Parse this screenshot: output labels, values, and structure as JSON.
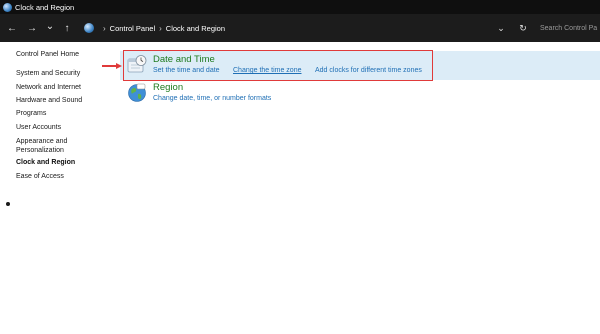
{
  "window": {
    "title": "Clock and Region"
  },
  "nav": {
    "back": "←",
    "forward": "→",
    "dropdown": "⌄",
    "up": "↑",
    "refresh": "↻",
    "history": "⌄"
  },
  "breadcrumb": {
    "items": [
      "Control Panel",
      "Clock and Region"
    ],
    "separator": "›"
  },
  "search": {
    "placeholder": "Search Control Pa"
  },
  "sidebar": {
    "items": [
      {
        "label": "Control Panel Home"
      },
      {
        "label": "System and Security"
      },
      {
        "label": "Network and Internet"
      },
      {
        "label": "Hardware and Sound"
      },
      {
        "label": "Programs"
      },
      {
        "label": "User Accounts"
      },
      {
        "label": "Appearance and"
      },
      {
        "label": "Personalization"
      },
      {
        "label": "Clock and Region",
        "active": true
      },
      {
        "label": "Ease of Access"
      }
    ]
  },
  "categories": [
    {
      "title": "Date and Time",
      "icon": "date-time-icon",
      "links": [
        "Set the time and date",
        "Change the time zone",
        "Add clocks for different time zones"
      ]
    },
    {
      "title": "Region",
      "icon": "region-globe-icon",
      "links": [
        "Change date, time, or number formats"
      ]
    }
  ],
  "colors": {
    "accent_highlight": "#dcecf7",
    "annotation_red": "#e03a3a",
    "title_green": "#1e7a1e",
    "link_blue": "#1f6fb5",
    "titlebar_bg": "#0f0f0f",
    "addressbar_bg": "#1c1c1c"
  }
}
